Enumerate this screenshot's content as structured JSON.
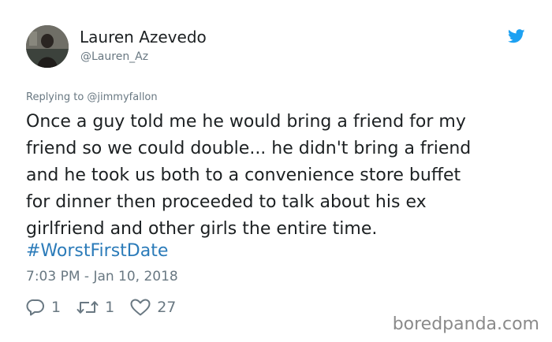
{
  "author": {
    "display_name": "Lauren Azevedo",
    "handle": "@Lauren_Az"
  },
  "replying_to": "Replying to @jimmyfallon",
  "tweet": {
    "lines": [
      "Once a guy told me he would bring a friend for my",
      "friend so we could double... he didn't bring a friend",
      "and he took us both to a convenience store buffet",
      "for dinner then proceeded to talk about his ex",
      "girlfriend and other girls the entire time."
    ],
    "hashtag": "#WorstFirstDate",
    "timestamp": "7:03 PM - Jan 10, 2018"
  },
  "actions": {
    "reply_count": "1",
    "retweet_count": "1",
    "like_count": "27"
  },
  "icons": {
    "brand": "twitter-bird-icon",
    "reply": "reply-icon",
    "retweet": "retweet-icon",
    "like": "heart-icon"
  },
  "colors": {
    "twitter_blue": "#1da1f2",
    "hashtag": "#2b7bb9",
    "secondary_text": "#697882",
    "primary_text": "#1c2022"
  },
  "watermark": "boredpanda.com"
}
